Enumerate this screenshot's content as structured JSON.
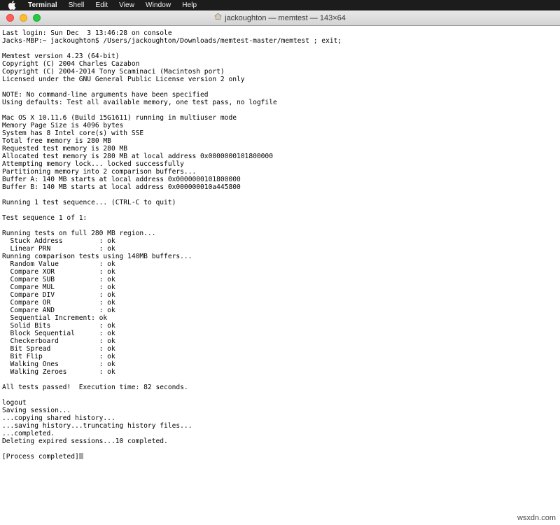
{
  "menubar": {
    "apple_icon": "apple-logo-icon",
    "items": [
      {
        "label": "Terminal",
        "bold": true
      },
      {
        "label": "Shell",
        "bold": false
      },
      {
        "label": "Edit",
        "bold": false
      },
      {
        "label": "View",
        "bold": false
      },
      {
        "label": "Window",
        "bold": false
      },
      {
        "label": "Help",
        "bold": false
      }
    ]
  },
  "window": {
    "title": "jackoughton — memtest — 143×64",
    "title_icon": "home-icon",
    "controls": {
      "close_label": "Close",
      "minimize_label": "Minimize",
      "zoom_label": "Zoom"
    },
    "colors": {
      "close": "#ff5f57",
      "minimize": "#ffbd2e",
      "zoom": "#28c940",
      "terminal_background": "#ffffff",
      "terminal_text": "#000000",
      "cursor": "#a8a8a8"
    }
  },
  "terminal": {
    "columns": 143,
    "rows": 64,
    "output": "Last login: Sun Dec  3 13:46:28 on console\nJacks-MBP:~ jackoughton$ /Users/jackoughton/Downloads/memtest-master/memtest ; exit;\n\nMemtest version 4.23 (64-bit)\nCopyright (C) 2004 Charles Cazabon\nCopyright (C) 2004-2014 Tony Scaminaci (Macintosh port)\nLicensed under the GNU General Public License version 2 only\n\nNOTE: No command-line arguments have been specified\nUsing defaults: Test all available memory, one test pass, no logfile\n\nMac OS X 10.11.6 (Build 15G1611) running in multiuser mode\nMemory Page Size is 4096 bytes\nSystem has 8 Intel core(s) with SSE\nTotal free memory is 280 MB\nRequested test memory is 280 MB\nAllocated test memory is 280 MB at local address 0x0000000101800000\nAttempting memory lock... locked successfully\nPartitioning memory into 2 comparison buffers...\nBuffer A: 140 MB starts at local address 0x0000000101800000\nBuffer B: 140 MB starts at local address 0x000000010a445800\n\nRunning 1 test sequence... (CTRL-C to quit)\n\nTest sequence 1 of 1:\n\nRunning tests on full 280 MB region...\n  Stuck Address         : ok\n  Linear PRN            : ok\nRunning comparison tests using 140MB buffers...\n  Random Value          : ok\n  Compare XOR           : ok\n  Compare SUB           : ok\n  Compare MUL           : ok\n  Compare DIV           : ok\n  Compare OR            : ok\n  Compare AND           : ok\n  Sequential Increment: ok\n  Solid Bits            : ok\n  Block Sequential      : ok\n  Checkerboard          : ok\n  Bit Spread            : ok\n  Bit Flip              : ok\n  Walking Ones          : ok\n  Walking Zeroes        : ok\n\nAll tests passed!  Execution time: 82 seconds.\n\nlogout\nSaving session...\n...copying shared history...\n...saving history...truncating history files...\n...completed.\nDeleting expired sessions...10 completed.\n\n[Process completed]"
  },
  "watermark": {
    "text": "wsxdn.com"
  }
}
